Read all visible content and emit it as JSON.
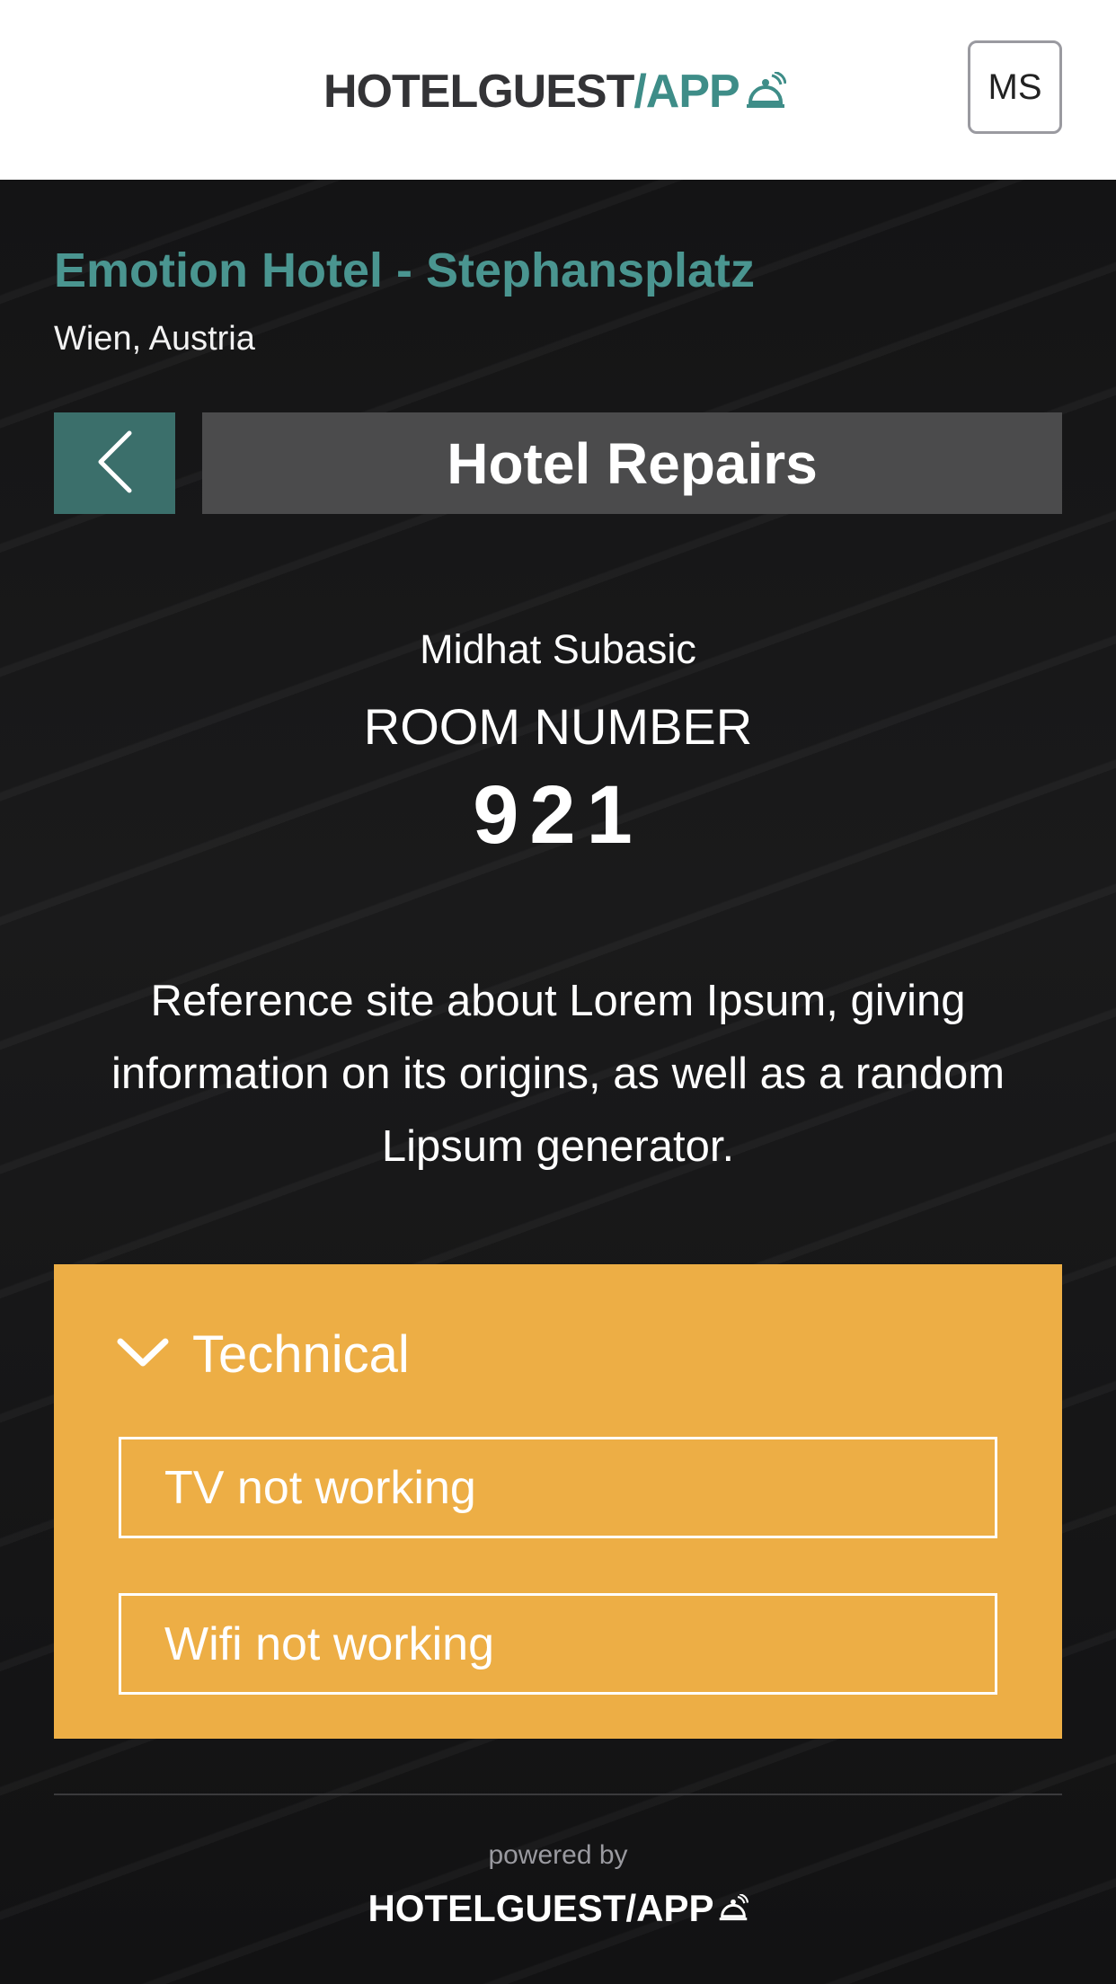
{
  "header": {
    "logo_main": "HOTELGUEST",
    "logo_accent": "/APP",
    "user_initials": "MS",
    "colors": {
      "logo_dark": "#333336",
      "logo_accent": "#3e8d88"
    }
  },
  "hotel": {
    "name": "Emotion Hotel - Stephansplatz",
    "location": "Wien, Austria"
  },
  "page": {
    "title": "Hotel Repairs",
    "back_icon": "chevron-left-icon"
  },
  "guest": {
    "name": "Midhat Subasic",
    "room_label": "ROOM NUMBER",
    "room_number": "921"
  },
  "description": "Reference site about Lorem Ipsum, giving information on its origins, as well as a random Lipsum generator.",
  "category": {
    "title": "Technical",
    "icon": "chevron-down-icon",
    "color": "#edae45",
    "options": [
      {
        "label": "TV not working"
      },
      {
        "label": "Wifi not working"
      }
    ]
  },
  "footer": {
    "powered_by": "powered by",
    "logo": "HOTELGUEST/APP"
  }
}
